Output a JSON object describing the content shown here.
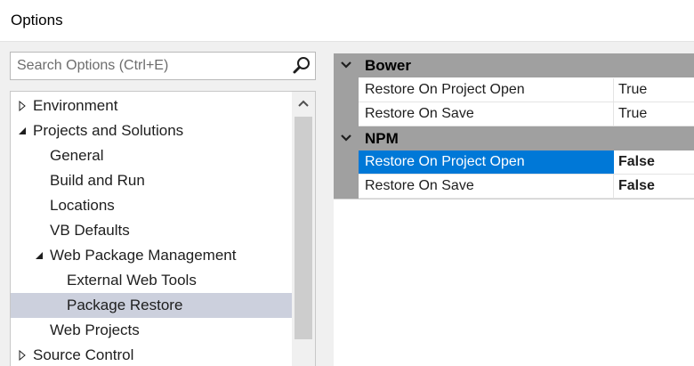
{
  "window": {
    "title": "Options"
  },
  "search": {
    "placeholder": "Search Options (Ctrl+E)",
    "icon": "search-icon"
  },
  "tree": {
    "items": [
      {
        "label": "Environment",
        "expander": "collapsed"
      },
      {
        "label": "Projects and Solutions",
        "expander": "expanded"
      },
      {
        "label": "General",
        "expander": "none"
      },
      {
        "label": "Build and Run",
        "expander": "none"
      },
      {
        "label": "Locations",
        "expander": "none"
      },
      {
        "label": "VB Defaults",
        "expander": "none"
      },
      {
        "label": "Web Package Management",
        "expander": "expanded"
      },
      {
        "label": "External Web Tools",
        "expander": "none"
      },
      {
        "label": "Package Restore",
        "expander": "none",
        "selected": true
      },
      {
        "label": "Web Projects",
        "expander": "none"
      },
      {
        "label": "Source Control",
        "expander": "collapsed"
      }
    ]
  },
  "properties": {
    "categories": [
      {
        "name": "Bower",
        "rows": [
          {
            "name": "Restore On Project Open",
            "value": "True"
          },
          {
            "name": "Restore On Save",
            "value": "True"
          }
        ]
      },
      {
        "name": "NPM",
        "rows": [
          {
            "name": "Restore On Project Open",
            "value": "False",
            "selected": true
          },
          {
            "name": "Restore On Save",
            "value": "False"
          }
        ]
      }
    ]
  },
  "colors": {
    "selection_blue": "#0078d7",
    "tree_selection": "#ccd0dd",
    "category_gray": "#a0a0a0"
  }
}
